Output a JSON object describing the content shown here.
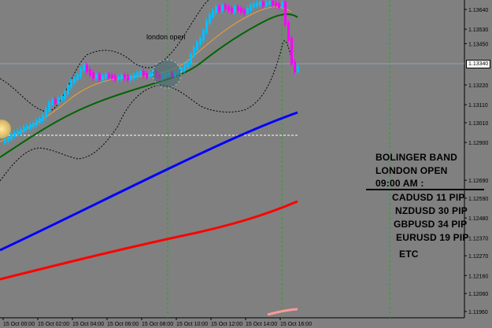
{
  "chart": {
    "background": "#808080",
    "current_price": "1.13340",
    "event_label": "london open",
    "price_ticks": [
      {
        "label": "1.13640",
        "price": 1.1364
      },
      {
        "label": "1.13530",
        "price": 1.1353
      },
      {
        "label": "1.13450",
        "price": 1.1345
      },
      {
        "label": "1.13220",
        "price": 1.1322
      },
      {
        "label": "1.13110",
        "price": 1.1311
      },
      {
        "label": "1.13010",
        "price": 1.1301
      },
      {
        "label": "1.12900",
        "price": 1.129
      },
      {
        "label": "1.12690",
        "price": 1.1269
      },
      {
        "label": "1.12590",
        "price": 1.1259
      },
      {
        "label": "1.12480",
        "price": 1.1248
      },
      {
        "label": "1.12370",
        "price": 1.1237
      },
      {
        "label": "1.12270",
        "price": 1.1227
      },
      {
        "label": "1.12160",
        "price": 1.1216
      },
      {
        "label": "1.12060",
        "price": 1.1206
      },
      {
        "label": "1.11960",
        "price": 1.1196
      }
    ],
    "time_ticks": [
      "15 Oct 00:00",
      "15 Oct 02:00",
      "15 Oct 04:00",
      "15 Oct 06:00",
      "15 Oct 08:00",
      "15 Oct 10:00",
      "15 Oct 12:00",
      "15 Oct 14:00",
      "15 Oct 16:00"
    ],
    "colors": {
      "bull_candle": "#00bfff",
      "bear_candle": "#ff00ff",
      "ma_fast": "#f0a030",
      "ma_slow": "#006400",
      "ma_blue": "#0000ff",
      "ma_red": "#ff0000",
      "ma_pink": "#ff9999",
      "bollinger": "#000000",
      "session_line": "#00c000"
    }
  },
  "annotation": {
    "title_line1": "BOLINGER BAND",
    "title_line2": "LONDON OPEN",
    "title_line3": "09:00 AM :",
    "pairs": [
      "CADUSD 11 PIP",
      "NZDUSD 30 PIP",
      "GBPUSD 34 PIP",
      "EURUSD 19 PIP"
    ],
    "footer": "ETC"
  }
}
